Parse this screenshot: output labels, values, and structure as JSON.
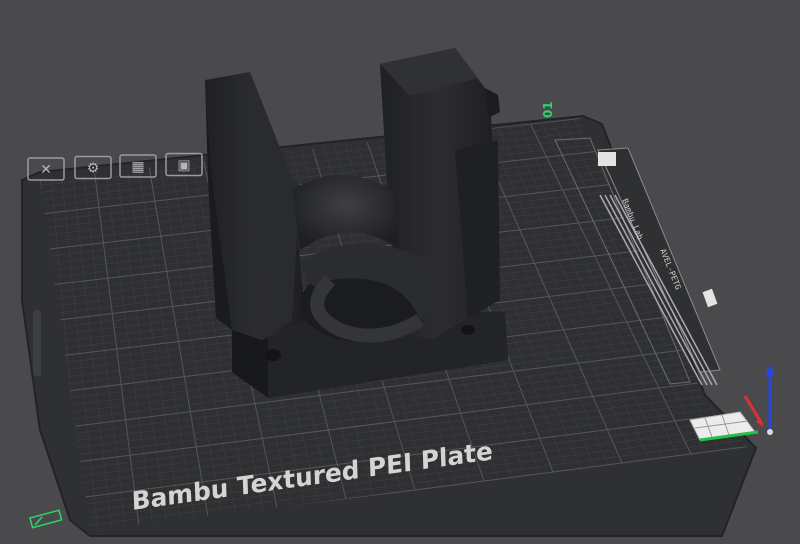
{
  "viewport": {
    "plate_label": "Bambu Textured PEI Plate",
    "plate_number": "01",
    "strip_texts": [
      "Bambu Lab",
      "AVEL-PETG"
    ],
    "colors": {
      "background": "#4a4a4c",
      "plate": "#2f3032",
      "grid_minor": "#3e3f42",
      "grid_major": "#56575b",
      "model": "#26272a",
      "plate_label": "#d4d4d4",
      "plate_number": "#2ed46a",
      "axis_x": "#e03030",
      "axis_y": "#22c04a",
      "axis_z": "#2448e0"
    }
  },
  "plate_icons": [
    {
      "name": "close-object-icon",
      "glyph": "✕"
    },
    {
      "name": "auto-arrange-icon",
      "glyph": "⚙"
    },
    {
      "name": "grid-layout-icon",
      "glyph": "▦"
    },
    {
      "name": "plate-settings-icon",
      "glyph": "▣"
    }
  ]
}
